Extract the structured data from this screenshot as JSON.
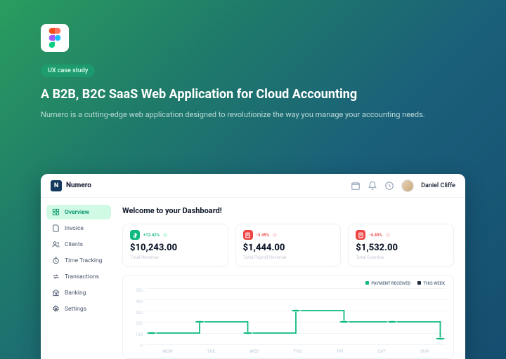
{
  "hero": {
    "pill": "UX case study",
    "title": "A B2B, B2C SaaS Web Application for Cloud Accounting",
    "subtitle": "Numero is a cutting-edge web application designed to revolutionize the way you manage your accounting needs."
  },
  "app": {
    "brand": "Numero",
    "user": "Daniel Cliffe"
  },
  "sidebar": {
    "items": [
      {
        "label": "Overview",
        "icon": "grid",
        "active": true
      },
      {
        "label": "Invoice",
        "icon": "file",
        "active": false
      },
      {
        "label": "Clients",
        "icon": "users",
        "active": false
      },
      {
        "label": "Time Tracking",
        "icon": "clock",
        "active": false
      },
      {
        "label": "Transactions",
        "icon": "transfer",
        "active": false
      },
      {
        "label": "Banking",
        "icon": "bank",
        "active": false
      },
      {
        "label": "Settings",
        "icon": "gear",
        "active": false
      }
    ]
  },
  "dashboard": {
    "welcome": "Welcome to your Dashboard!",
    "stats": [
      {
        "delta": "+12.42%",
        "dir": "up",
        "amount": "$10,243.00",
        "label": "Total Revenue",
        "color": "green"
      },
      {
        "delta": "-3.45%",
        "dir": "down",
        "amount": "$1,444.00",
        "label": "Total Payroll Revenue",
        "color": "red"
      },
      {
        "delta": "-4.45%",
        "dir": "down",
        "amount": "$1,532.00",
        "label": "Total Overdue",
        "color": "red"
      }
    ],
    "legend": {
      "a": "PAYMENT RECEIVED",
      "b": "THIS WEEK"
    }
  },
  "chart_data": {
    "type": "line",
    "categories": [
      "MON",
      "TUE",
      "WED",
      "THU",
      "FRI",
      "SAT",
      "SUN"
    ],
    "series": [
      {
        "name": "PAYMENT RECEIVED",
        "values": [
          100,
          200,
          100,
          300,
          200,
          200,
          50
        ]
      }
    ],
    "ylabel": "",
    "xlabel": "",
    "ylim": [
      0,
      500
    ],
    "yticks": [
      500,
      400,
      300,
      200,
      100,
      0
    ]
  }
}
